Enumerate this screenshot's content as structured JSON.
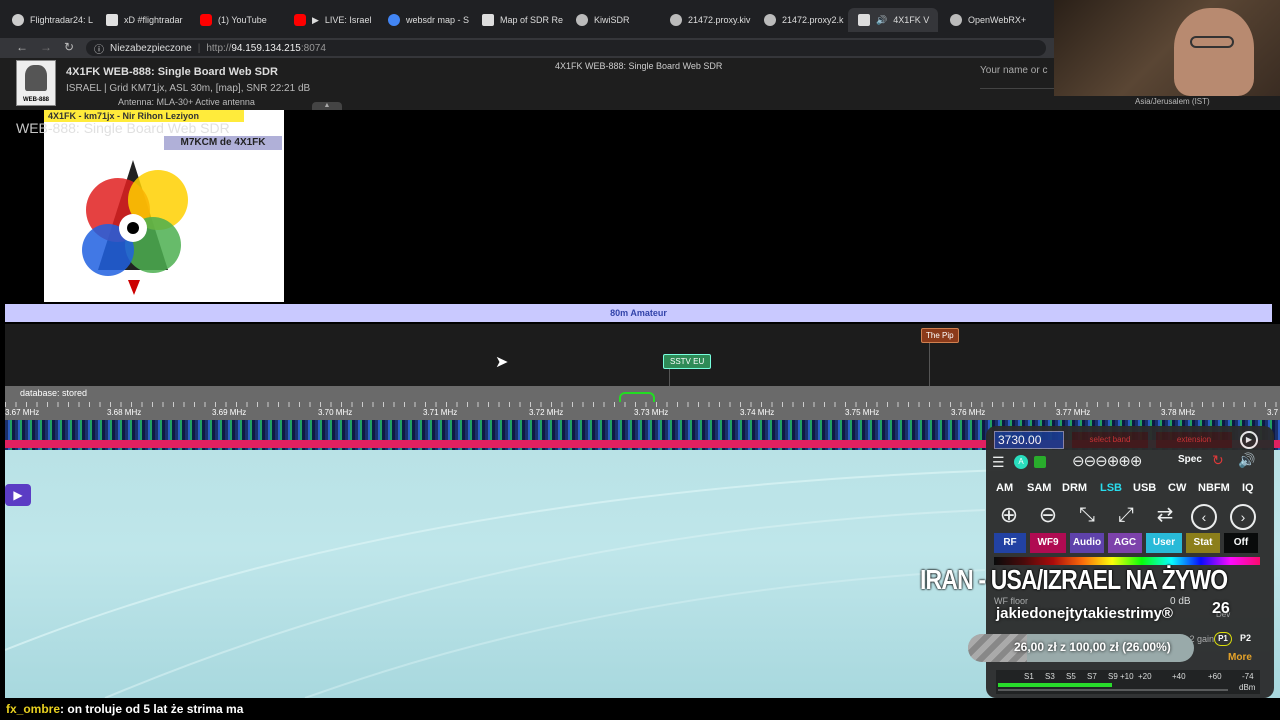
{
  "tabs": [
    {
      "label": "Flightradar24: L",
      "color": "#cccccc"
    },
    {
      "label": "xD #flightradar",
      "color": "#e0e0e0"
    },
    {
      "label": "(1) YouTube",
      "color": "#ff0000"
    },
    {
      "label": "LIVE: Israel",
      "color": "#ff0000"
    },
    {
      "label": "websdr map - S",
      "color": "#4285f4"
    },
    {
      "label": "Map of SDR Re",
      "color": "#dddddd"
    },
    {
      "label": "KiwiSDR",
      "color": "#bbbbbb"
    },
    {
      "label": "21472.proxy.kiv",
      "color": "#bbbbbb"
    },
    {
      "label": "21472.proxy2.k",
      "color": "#bbbbbb"
    },
    {
      "label": "4X1FK V",
      "color": "#dddddd"
    },
    {
      "label": "OpenWebRX+",
      "color": "#bbbbbb"
    }
  ],
  "addressbar": {
    "security": "Niezabezpieczone",
    "url_prefix": "http://",
    "url_host": "94.159.134.215",
    "url_port": ":8074"
  },
  "header": {
    "logo_text": "WEB-888",
    "title": "4X1FK WEB-888: Single Board Web SDR",
    "location": "ISRAEL | Grid KM71jx, ASL 30m, [map], SNR 22:21 dB",
    "antenna": "Antenna: MLA-30+ Active antenna",
    "center_title": "4X1FK WEB-888: Single Board Web SDR",
    "name_placeholder": "Your name or c",
    "timezone": "Asia/Jerusalem (IST)"
  },
  "picture": {
    "line1": "4X1FK - km71jx - Nir Rihon Leziyon",
    "line2": "M7KCM de 4X1FK",
    "overlay": "WEB-888: Single Board Web SDR"
  },
  "band": {
    "name": "80m Amateur",
    "labels": [
      "SSTV EU",
      "The Pip"
    ],
    "database": "database: stored"
  },
  "scale_ticks": [
    "3.67 MHz",
    "3.68 MHz",
    "3.69 MHz",
    "3.70 MHz",
    "3.71 MHz",
    "3.72 MHz",
    "3.73 MHz",
    "3.74 MHz",
    "3.75 MHz",
    "3.76 MHz",
    "3.77 MHz",
    "3.78 MHz",
    "3.7"
  ],
  "controls": {
    "frequency": "3730.00",
    "select_band": "select band",
    "extension": "extension",
    "spec": "Spec",
    "modes": [
      "AM",
      "SAM",
      "DRM",
      "LSB",
      "USB",
      "CW",
      "NBFM",
      "IQ"
    ],
    "active_mode": "LSB",
    "tabs": [
      {
        "label": "RF",
        "bg": "#1a3aa0"
      },
      {
        "label": "WF9",
        "bg": "#b0004a"
      },
      {
        "label": "Audio",
        "bg": "#5a3aa8"
      },
      {
        "label": "AGC",
        "bg": "#7a3aa8"
      },
      {
        "label": "User",
        "bg": "#22b8d8"
      },
      {
        "label": "Stat",
        "bg": "#8a7a10"
      },
      {
        "label": "Off",
        "bg": "#000000"
      }
    ],
    "wf_floor_label": "WF floor",
    "wf_floor_value": "0 dB",
    "gain": "0.2 gain",
    "p1": "P1",
    "p2": "P2",
    "more": "More",
    "dev": "Dev",
    "meter_labels": [
      "S1",
      "S3",
      "S5",
      "S7",
      "S9",
      "+10",
      "+20",
      "+40",
      "+60",
      "-74"
    ],
    "unit": "dBm"
  },
  "overlays": {
    "banner": "IRAN - USA/IZRAEL NA ŻYWO",
    "channel": "jakiedonejtytakiestrimy®",
    "counter": "26",
    "donation": "26,00 zł z 100,00 zł (26.00%)",
    "donation_progress": 0.26
  },
  "chat": {
    "user": "fx_ombre",
    "message": ": on troluje od 5 lat że strima ma"
  }
}
